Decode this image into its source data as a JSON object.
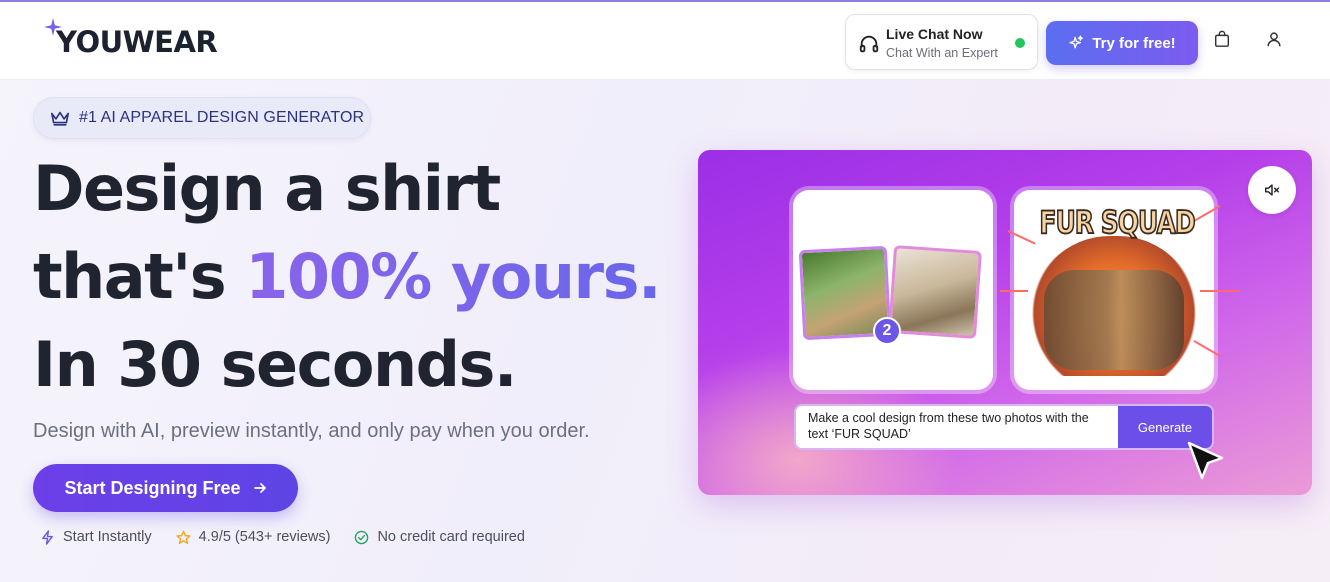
{
  "brand": {
    "logo_text": "YOUWEAR",
    "accent": "#7b61e9"
  },
  "header": {
    "chat": {
      "title": "Live Chat Now",
      "subtitle": "Chat With an Expert",
      "status_color": "#22c55e"
    },
    "try_button": "Try for free!",
    "icons": [
      "headset-icon",
      "sparkles-icon",
      "shopping-bag-icon",
      "user-icon"
    ]
  },
  "hero": {
    "badge": "#1 AI APPAREL DESIGN GENERATOR",
    "title_line1": "Design a shirt",
    "title_line2_prefix": "that's ",
    "title_line2_accent": "100% yours.",
    "title_line3": "In 30 seconds.",
    "subtitle": "Design with AI, preview instantly, and only pay when you order.",
    "cta": "Start Designing Free",
    "features": [
      {
        "icon": "lightning-icon",
        "label": "Start Instantly"
      },
      {
        "icon": "star-icon",
        "label": "4.9/5 (543+ reviews)"
      },
      {
        "icon": "check-circle-icon",
        "label": "No credit card required"
      }
    ]
  },
  "demo": {
    "photo_count_badge": "2",
    "design_text": "FUR SQUAD",
    "prompt": "Make a cool design from these two photos with the text ‘FUR SQUAD’",
    "generate_button": "Generate"
  }
}
